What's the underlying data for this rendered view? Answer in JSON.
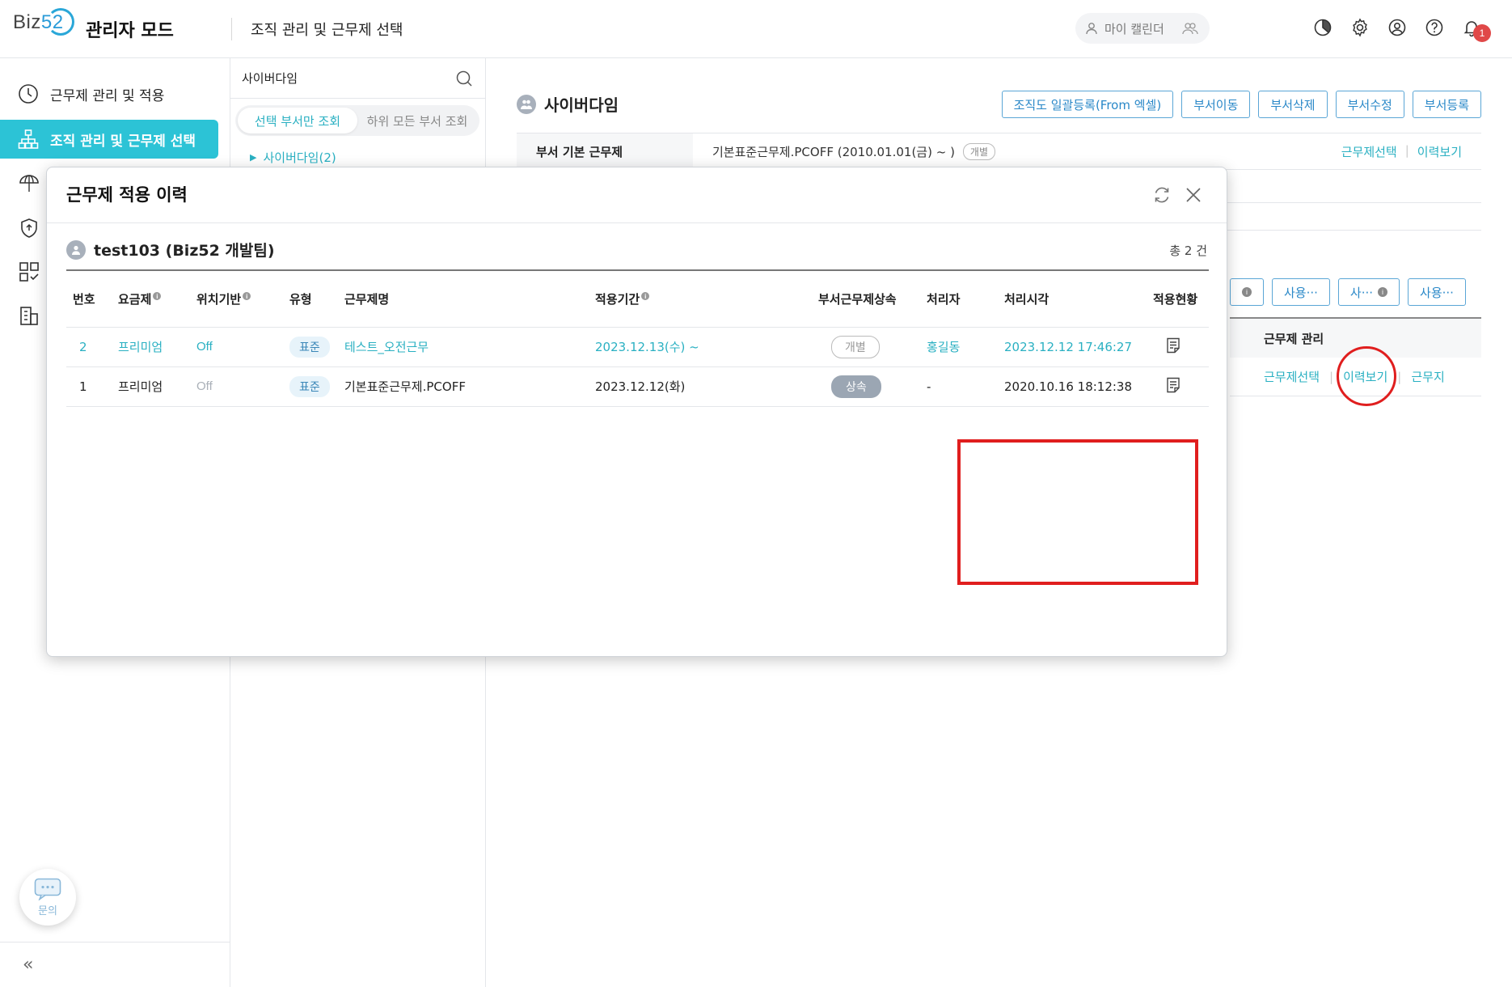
{
  "header": {
    "logo_text": "Biz",
    "logo_num": "52",
    "admin_mode": "관리자 모드",
    "page_title": "조직 관리 및 근무제 선택",
    "my_calendar": "마이 캘린더",
    "notif_count": "1"
  },
  "nav": {
    "items": [
      {
        "label": "근무제 관리 및 적용"
      },
      {
        "label": "조직 관리 및 근무제 선택"
      }
    ],
    "inquiry": "문의",
    "collapse": "«"
  },
  "tree": {
    "search_label": "사이버다임",
    "toggle_selected": "선택 부서만 조회",
    "toggle_all": "하위 모든 부서 조회",
    "node": "사이버다임(2)"
  },
  "main": {
    "org_name": "사이버다임",
    "buttons": [
      "조직도 일괄등록(From 엑셀)",
      "부서이동",
      "부서삭제",
      "부서수정",
      "부서등록"
    ],
    "info_label": "부서 기본 근무제",
    "info_value": "기본표준근무제.PCOFF (2010.01.01(금) ~ )",
    "info_chip": "개별",
    "info_link1": "근무제선택",
    "info_link2": "이력보기",
    "filters": [
      "사용···",
      "사···",
      "사용···"
    ],
    "right_header": "근무제 관리",
    "right_links": [
      "근무제선택",
      "이력보기",
      "근무지"
    ]
  },
  "modal": {
    "title": "근무제 적용 이력",
    "user": "test103 (Biz52 개발팀)",
    "total": "총 2 건",
    "columns": [
      "번호",
      "요금제",
      "위치기반",
      "유형",
      "근무제명",
      "적용기간",
      "부서근무제상속",
      "처리자",
      "처리시각",
      "적용현황"
    ],
    "rows": [
      {
        "no": "2",
        "plan": "프리미엄",
        "location": "Off",
        "type": "표준",
        "name": "테스트_오전근무",
        "period": "2023.12.13(수) ~",
        "inherit": "개별",
        "handler": "홍길동",
        "time": "2023.12.12 17:46:27"
      },
      {
        "no": "1",
        "plan": "프리미엄",
        "location": "Off",
        "type": "표준",
        "name": "기본표준근무제.PCOFF",
        "period": "2023.12.12(화)",
        "inherit": "상속",
        "handler": "-",
        "time": "2020.10.16 18:12:38"
      }
    ]
  },
  "colors": {
    "accent": "#2cc3d6",
    "link": "#2ab0c2",
    "button_border": "#5aa6d6",
    "highlight": "#e01e1e"
  }
}
